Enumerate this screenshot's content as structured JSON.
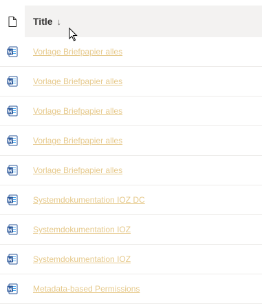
{
  "header": {
    "title_label": "Title",
    "sort_indicator": "↓",
    "file_type_icon": "document-icon"
  },
  "colors": {
    "header_bg": "#f3f2f1",
    "link": "#e6c98b",
    "word_blue": "#2b579a",
    "row_divider": "#edebe9"
  },
  "rows": [
    {
      "icon": "word-document-icon",
      "title": "Vorlage Briefpapier alles"
    },
    {
      "icon": "word-document-icon",
      "title": "Vorlage Briefpapier alles"
    },
    {
      "icon": "word-document-icon",
      "title": "Vorlage Briefpapier alles"
    },
    {
      "icon": "word-document-icon",
      "title": "Vorlage Briefpapier alles"
    },
    {
      "icon": "word-document-icon",
      "title": "Vorlage Briefpapier alles"
    },
    {
      "icon": "word-document-icon",
      "title": "Systemdokumentation IOZ DC"
    },
    {
      "icon": "word-document-icon",
      "title": "Systemdokumentation IOZ"
    },
    {
      "icon": "word-document-icon",
      "title": "Systemdokumentation IOZ"
    },
    {
      "icon": "word-document-icon",
      "title": "Metadata-based Permissions"
    }
  ]
}
